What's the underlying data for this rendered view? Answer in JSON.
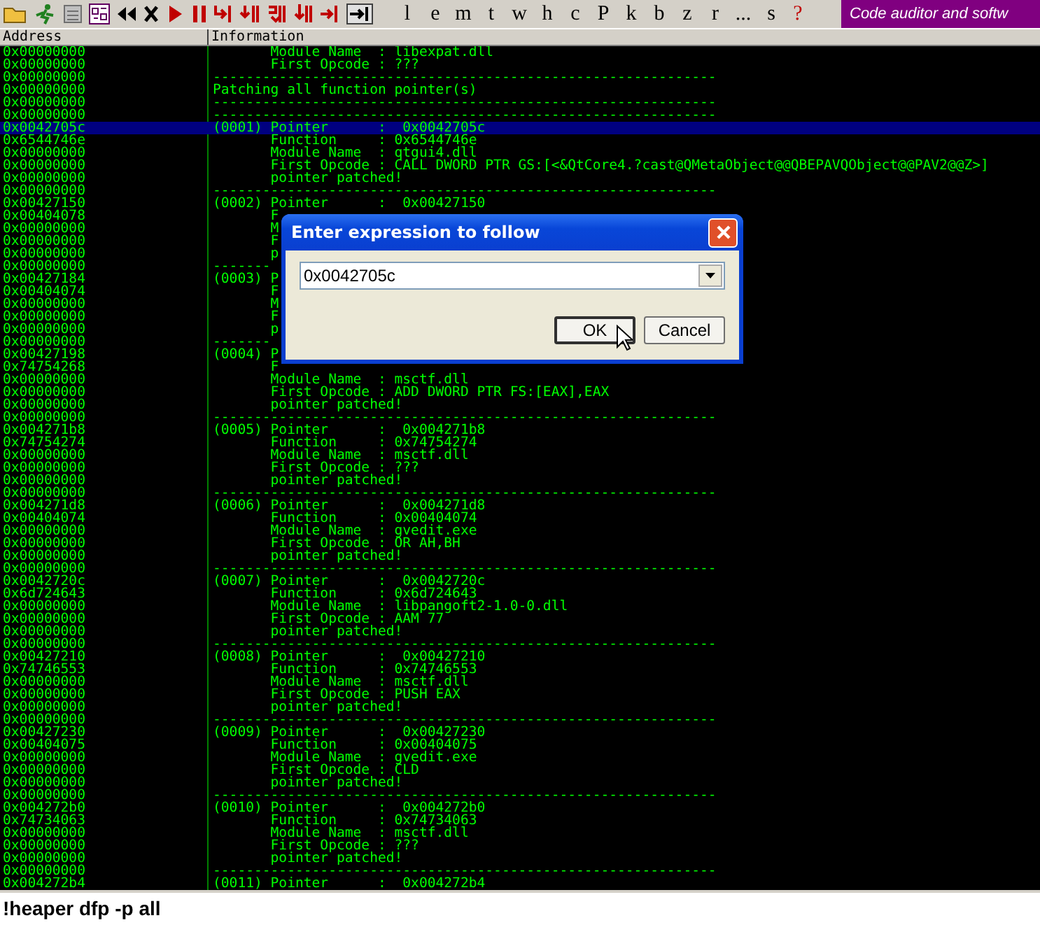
{
  "toolbar": {
    "letters": [
      "l",
      "e",
      "m",
      "t",
      "w",
      "h",
      "c",
      "P",
      "k",
      "b",
      "z",
      "r",
      "...",
      "s"
    ],
    "help": "?",
    "banner": "Code auditor and softw"
  },
  "columns": [
    "Address",
    "Information"
  ],
  "rows": [
    {
      "address": "0x00000000",
      "info": "       Module Name  : libexpat.dll",
      "selected": false
    },
    {
      "address": "0x00000000",
      "info": "       First Opcode : ???",
      "selected": false
    },
    {
      "address": "0x00000000",
      "info": "-------------------------------------------------------------",
      "selected": false
    },
    {
      "address": "0x00000000",
      "info": "Patching all function pointer(s)",
      "selected": false
    },
    {
      "address": "0x00000000",
      "info": "-------------------------------------------------------------",
      "selected": false
    },
    {
      "address": "0x00000000",
      "info": "-------------------------------------------------------------",
      "selected": false
    },
    {
      "address": "0x0042705c",
      "info": "(0001) Pointer      :  0x0042705c",
      "selected": true
    },
    {
      "address": "0x6544746e",
      "info": "       Function     : 0x6544746e",
      "selected": false
    },
    {
      "address": "0x00000000",
      "info": "       Module Name  : qtgui4.dll",
      "selected": false
    },
    {
      "address": "0x00000000",
      "info": "       First Opcode : CALL DWORD PTR GS:[<&QtCore4.?cast@QMetaObject@@QBEPAVQObject@@PAV2@@Z>]",
      "selected": false
    },
    {
      "address": "0x00000000",
      "info": "       pointer patched!",
      "selected": false
    },
    {
      "address": "0x00000000",
      "info": "-------------------------------------------------------------",
      "selected": false
    },
    {
      "address": "0x00427150",
      "info": "(0002) Pointer      :  0x00427150",
      "selected": false
    },
    {
      "address": "0x00404078",
      "info": "       F",
      "selected": false
    },
    {
      "address": "0x00000000",
      "info": "       M",
      "selected": false
    },
    {
      "address": "0x00000000",
      "info": "       F",
      "selected": false
    },
    {
      "address": "0x00000000",
      "info": "       p",
      "selected": false
    },
    {
      "address": "0x00000000",
      "info": "-------",
      "selected": false
    },
    {
      "address": "0x00427184",
      "info": "(0003) P",
      "selected": false
    },
    {
      "address": "0x00404074",
      "info": "       F",
      "selected": false
    },
    {
      "address": "0x00000000",
      "info": "       M",
      "selected": false
    },
    {
      "address": "0x00000000",
      "info": "       F",
      "selected": false
    },
    {
      "address": "0x00000000",
      "info": "       p",
      "selected": false
    },
    {
      "address": "0x00000000",
      "info": "-------",
      "selected": false
    },
    {
      "address": "0x00427198",
      "info": "(0004) P",
      "selected": false
    },
    {
      "address": "0x74754268",
      "info": "       F",
      "selected": false
    },
    {
      "address": "0x00000000",
      "info": "       Module Name  : msctf.dll",
      "selected": false
    },
    {
      "address": "0x00000000",
      "info": "       First Opcode : ADD DWORD PTR FS:[EAX],EAX",
      "selected": false
    },
    {
      "address": "0x00000000",
      "info": "       pointer patched!",
      "selected": false
    },
    {
      "address": "0x00000000",
      "info": "-------------------------------------------------------------",
      "selected": false
    },
    {
      "address": "0x004271b8",
      "info": "(0005) Pointer      :  0x004271b8",
      "selected": false
    },
    {
      "address": "0x74754274",
      "info": "       Function     : 0x74754274",
      "selected": false
    },
    {
      "address": "0x00000000",
      "info": "       Module Name  : msctf.dll",
      "selected": false
    },
    {
      "address": "0x00000000",
      "info": "       First Opcode : ???",
      "selected": false
    },
    {
      "address": "0x00000000",
      "info": "       pointer patched!",
      "selected": false
    },
    {
      "address": "0x00000000",
      "info": "-------------------------------------------------------------",
      "selected": false
    },
    {
      "address": "0x004271d8",
      "info": "(0006) Pointer      :  0x004271d8",
      "selected": false
    },
    {
      "address": "0x00404074",
      "info": "       Function     : 0x00404074",
      "selected": false
    },
    {
      "address": "0x00000000",
      "info": "       Module Name  : gvedit.exe",
      "selected": false
    },
    {
      "address": "0x00000000",
      "info": "       First Opcode : OR AH,BH",
      "selected": false
    },
    {
      "address": "0x00000000",
      "info": "       pointer patched!",
      "selected": false
    },
    {
      "address": "0x00000000",
      "info": "-------------------------------------------------------------",
      "selected": false
    },
    {
      "address": "0x0042720c",
      "info": "(0007) Pointer      :  0x0042720c",
      "selected": false
    },
    {
      "address": "0x6d724643",
      "info": "       Function     : 0x6d724643",
      "selected": false
    },
    {
      "address": "0x00000000",
      "info": "       Module Name  : libpangoft2-1.0-0.dll",
      "selected": false
    },
    {
      "address": "0x00000000",
      "info": "       First Opcode : AAM 77",
      "selected": false
    },
    {
      "address": "0x00000000",
      "info": "       pointer patched!",
      "selected": false
    },
    {
      "address": "0x00000000",
      "info": "-------------------------------------------------------------",
      "selected": false
    },
    {
      "address": "0x00427210",
      "info": "(0008) Pointer      :  0x00427210",
      "selected": false
    },
    {
      "address": "0x74746553",
      "info": "       Function     : 0x74746553",
      "selected": false
    },
    {
      "address": "0x00000000",
      "info": "       Module Name  : msctf.dll",
      "selected": false
    },
    {
      "address": "0x00000000",
      "info": "       First Opcode : PUSH EAX",
      "selected": false
    },
    {
      "address": "0x00000000",
      "info": "       pointer patched!",
      "selected": false
    },
    {
      "address": "0x00000000",
      "info": "-------------------------------------------------------------",
      "selected": false
    },
    {
      "address": "0x00427230",
      "info": "(0009) Pointer      :  0x00427230",
      "selected": false
    },
    {
      "address": "0x00404075",
      "info": "       Function     : 0x00404075",
      "selected": false
    },
    {
      "address": "0x00000000",
      "info": "       Module Name  : gvedit.exe",
      "selected": false
    },
    {
      "address": "0x00000000",
      "info": "       First Opcode : CLD",
      "selected": false
    },
    {
      "address": "0x00000000",
      "info": "       pointer patched!",
      "selected": false
    },
    {
      "address": "0x00000000",
      "info": "-------------------------------------------------------------",
      "selected": false
    },
    {
      "address": "0x004272b0",
      "info": "(0010) Pointer      :  0x004272b0",
      "selected": false
    },
    {
      "address": "0x74734063",
      "info": "       Function     : 0x74734063",
      "selected": false
    },
    {
      "address": "0x00000000",
      "info": "       Module Name  : msctf.dll",
      "selected": false
    },
    {
      "address": "0x00000000",
      "info": "       First Opcode : ???",
      "selected": false
    },
    {
      "address": "0x00000000",
      "info": "       pointer patched!",
      "selected": false
    },
    {
      "address": "0x00000000",
      "info": "-------------------------------------------------------------",
      "selected": false
    },
    {
      "address": "0x004272b4",
      "info": "(0011) Pointer      :  0x004272b4",
      "selected": false
    }
  ],
  "dialog": {
    "title": "Enter expression to follow",
    "value": "0x0042705c",
    "buttons": [
      "OK",
      "Cancel"
    ]
  },
  "command": "!heaper dfp -p all"
}
